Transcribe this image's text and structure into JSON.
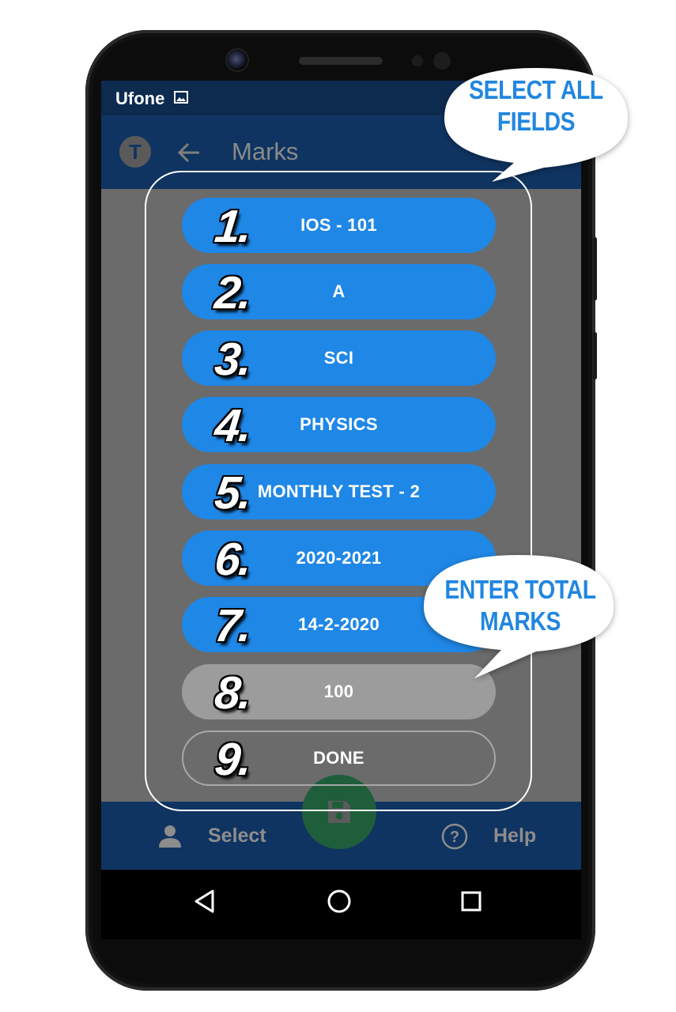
{
  "status_bar": {
    "carrier": "Ufone",
    "icon": "image-icon"
  },
  "app_bar": {
    "avatar_letter": "T",
    "title": "Marks",
    "back_icon": "arrow-left-icon"
  },
  "form_fields": [
    {
      "number": "1.",
      "value": "IOS - 101"
    },
    {
      "number": "2.",
      "value": "A"
    },
    {
      "number": "3.",
      "value": "SCI"
    },
    {
      "number": "4.",
      "value": "PHYSICS"
    },
    {
      "number": "5.",
      "value": "MONTHLY TEST - 2"
    },
    {
      "number": "6.",
      "value": "2020-2021"
    },
    {
      "number": "7.",
      "value": "14-2-2020"
    },
    {
      "number": "8.",
      "value": "100"
    },
    {
      "number": "9.",
      "value": "DONE"
    }
  ],
  "bottom_nav": {
    "select_label": "Select",
    "help_label": "Help",
    "fab_icon": "save-icon"
  },
  "callouts": {
    "select_all": {
      "line1": "SELECT ALL",
      "line2": "FIELDS"
    },
    "enter_total": {
      "line1": "ENTER TOTAL",
      "line2": "MARKS"
    }
  },
  "colors": {
    "field_blue": "#1f87e6",
    "app_bar": "#0f3461",
    "fab": "#1e5e3a",
    "callout_text": "#2186e0"
  }
}
